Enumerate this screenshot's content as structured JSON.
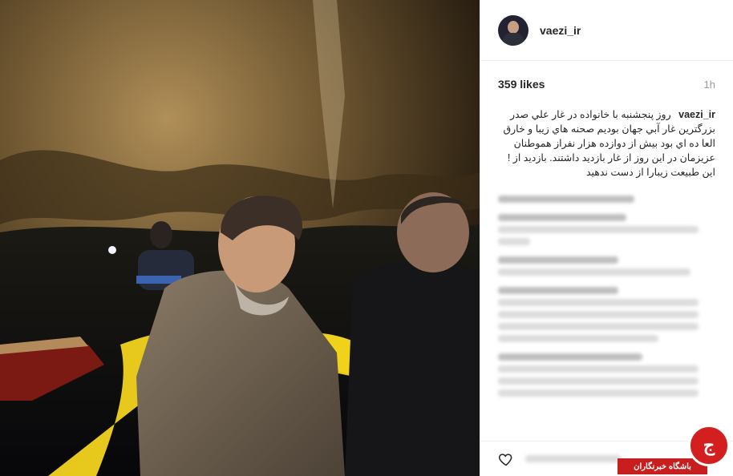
{
  "post": {
    "username": "vaezi_ir",
    "likes": "359 likes",
    "time": "1h",
    "caption_user": "vaezi_ir",
    "caption_text": "روز پنجشنبه با خانواده در غار علي صدر بزرگترين غار آبي جهان بوديم صحنه هاي زيبا و خارق العا ده اي بود بيش از دوازده هزار نفراز هموطنان عزيزمان در اين روز از غار بازديد داشتند. بازديد از !اين طبيعت زيبارا از دست ندهيد"
  },
  "watermark": {
    "label": "باشگاه خبرنگاران",
    "glyph": "ج"
  },
  "colors": {
    "watermark_red": "#c81e1e",
    "boat_yellow": "#f0d21a"
  }
}
